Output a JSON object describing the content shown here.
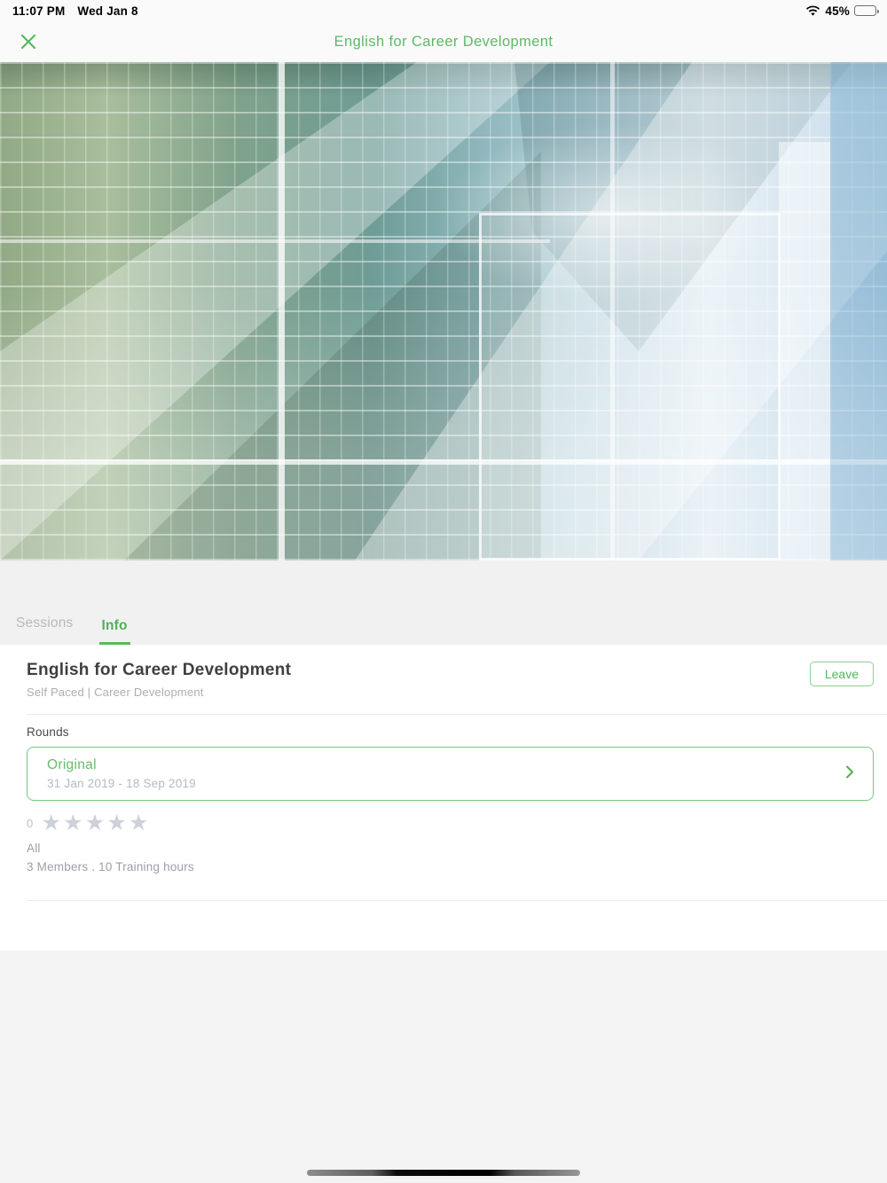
{
  "status_bar": {
    "time": "11:07 PM",
    "date": "Wed Jan 8",
    "battery_percent": "45%"
  },
  "navbar": {
    "title": "English for Career Development"
  },
  "hero": {
    "description": "abstract green and blue grid pattern course banner"
  },
  "tabs": {
    "sessions_label": "Sessions",
    "info_label": "Info",
    "active_tab": "Info"
  },
  "course": {
    "title": "English for Career Development",
    "subtitle": "Self Paced | Career Development",
    "leave_label": "Leave",
    "rounds_label": "Rounds",
    "round": {
      "name": "Original",
      "dates": "31 Jan 2019 - 18 Sep 2019"
    },
    "rating": {
      "value": "0",
      "stars": 5,
      "star_glyph": "★"
    },
    "audience": "All",
    "meta": "3 Members . 10 Training hours"
  },
  "colors": {
    "accent_green": "#5cb85c",
    "inactive_tab_gray": "#b9b9b9",
    "star_gray": "#ccd1da",
    "muted_text": "#9aa0aa",
    "title_text": "#3f3f3f"
  }
}
